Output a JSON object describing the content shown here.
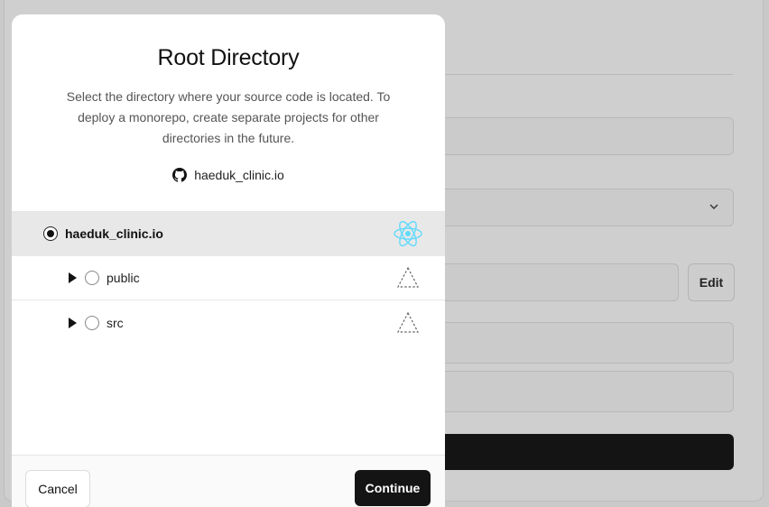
{
  "modal": {
    "title": "Root Directory",
    "description": "Select the directory where your source code is located. To deploy a monorepo, create separate projects for other directories in the future.",
    "repo_name": "haeduk_clinic.io",
    "repo_icon": "github-icon"
  },
  "tree": {
    "root": {
      "label": "haeduk_clinic.io",
      "selected": true,
      "framework_icon": "react-icon"
    },
    "items": [
      {
        "label": "public",
        "selected": false,
        "framework_icon": "unknown-framework-icon"
      },
      {
        "label": "src",
        "selected": false,
        "framework_icon": "unknown-framework-icon"
      }
    ]
  },
  "footer": {
    "cancel_label": "Cancel",
    "continue_label": "Continue"
  },
  "background": {
    "edit_label": "Edit"
  },
  "colors": {
    "react_accent": "#61dafb",
    "primary_button": "#141414"
  }
}
